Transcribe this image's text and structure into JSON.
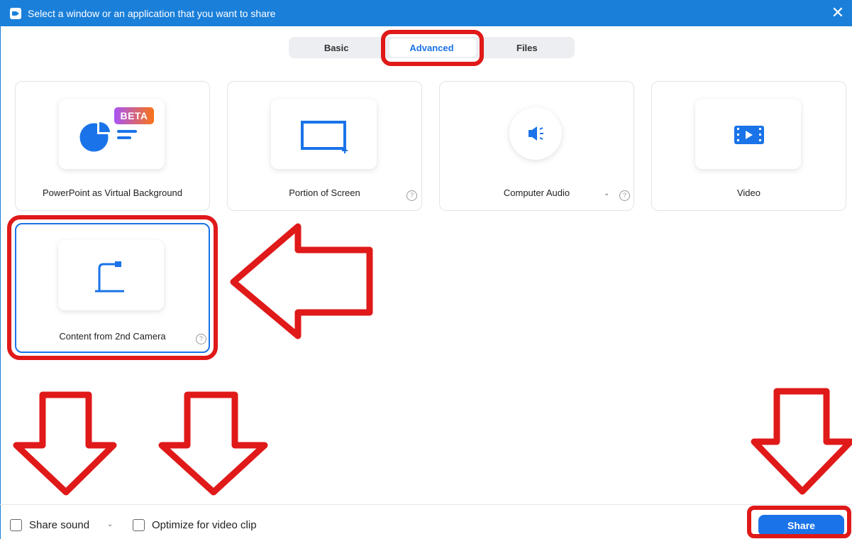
{
  "window": {
    "title": "Select a window or an application that you want to share",
    "close_glyph": "✕"
  },
  "tabs": [
    {
      "label": "Basic",
      "active": false
    },
    {
      "label": "Advanced",
      "active": true
    },
    {
      "label": "Files",
      "active": false
    }
  ],
  "cards": {
    "powerpoint": {
      "label": "PowerPoint as Virtual Background",
      "badge": "BETA"
    },
    "portion": {
      "label": "Portion of Screen",
      "help": "?"
    },
    "audio": {
      "label": "Computer Audio",
      "help": "?",
      "chevron": "⌄"
    },
    "video": {
      "label": "Video"
    },
    "camera": {
      "label": "Content from 2nd Camera",
      "help": "?",
      "selected": true
    }
  },
  "footer": {
    "share_sound_label": "Share sound",
    "share_sound_checked": false,
    "share_sound_chevron": "⌄",
    "optimize_label": "Optimize for video clip",
    "optimize_checked": false,
    "share_button": "Share"
  },
  "colors": {
    "accent": "#1a73e8",
    "titlebar": "#1a7fd9",
    "annotation_red": "#e01919"
  }
}
